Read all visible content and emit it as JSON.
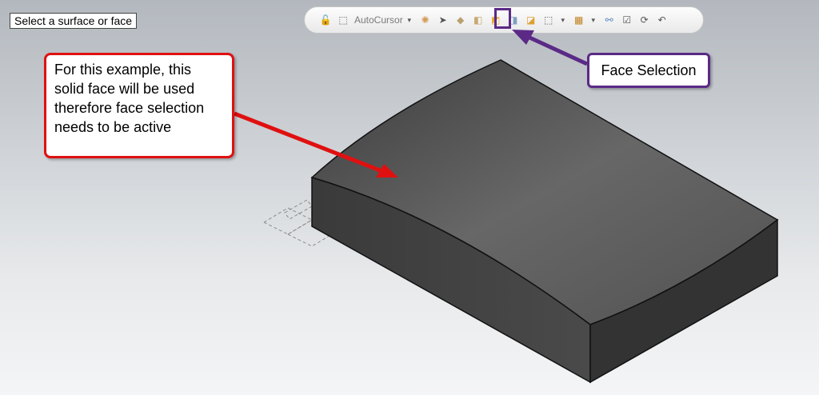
{
  "prompt": {
    "text": "Select a surface or face"
  },
  "toolbar": {
    "autocursor_label": "AutoCursor",
    "icons": [
      "lock-icon",
      "cursor-icon",
      "gear-icon",
      "arrow-icon",
      "body-icon",
      "surface-icon",
      "face-icon",
      "solid-icon",
      "solid2-icon",
      "select-icon",
      "box-select-icon",
      "link-icon",
      "pick-icon",
      "rotate-icon",
      "undo-icon"
    ]
  },
  "annotations": {
    "red_callout": "For this example, this solid face will be used therefore face selection needs to be active",
    "purple_callout": "Face Selection"
  },
  "colors": {
    "red": "#e01010",
    "purple": "#5b2a86",
    "solid": "#4a4a4a"
  }
}
